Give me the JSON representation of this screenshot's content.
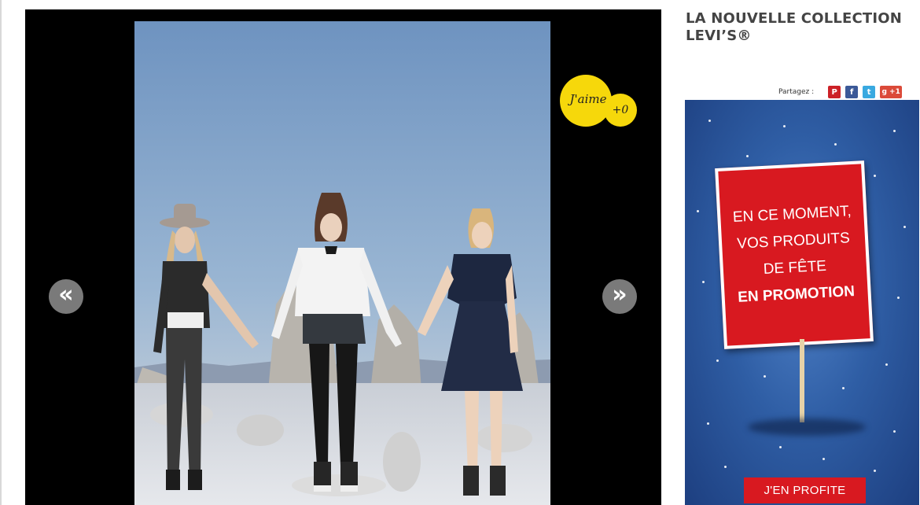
{
  "slideshow": {
    "prev_label": "«",
    "next_label": "»",
    "like_label": "J'aime",
    "like_count": "+0"
  },
  "sidebar": {
    "title": "LA NOUVELLE COLLECTION LEVI’S®",
    "share": {
      "label": "Partagez :",
      "icons": [
        "pinterest-icon",
        "facebook-icon",
        "twitter-icon",
        "google-plus-icon"
      ],
      "pinterest": "P",
      "facebook": "f",
      "twitter": "t",
      "google_plus": "g +1"
    }
  },
  "ad": {
    "line1": "EN CE MOMENT,",
    "line2": "VOS PRODUITS",
    "line3": "DE FÊTE",
    "line4": "EN PROMOTION",
    "cta": "J'EN PROFITE"
  },
  "colors": {
    "like_yellow": "#f6d80b",
    "ad_red": "#d81920",
    "ad_blue": "#2f5ea5",
    "nav_gray": "#7a7a7a"
  }
}
